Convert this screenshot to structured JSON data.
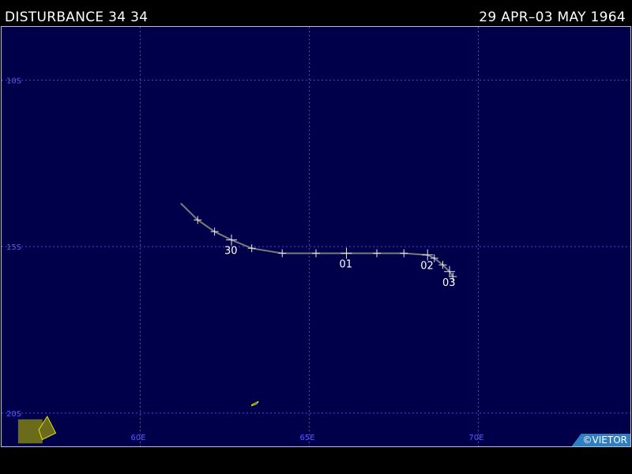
{
  "header": {
    "title": "DISTURBANCE 34 34",
    "date_range": "29 APR–03 MAY 1964"
  },
  "map": {
    "lon_range": [
      55.9,
      74.5
    ],
    "lat_range": [
      -21.0,
      -8.4
    ],
    "lat_grid": [
      {
        "lat": -10,
        "label": "10S"
      },
      {
        "lat": -15,
        "label": "15S"
      },
      {
        "lat": -20,
        "label": "20S"
      }
    ],
    "lon_grid": [
      {
        "lon": 60,
        "label": "60E"
      },
      {
        "lon": 65,
        "label": "65E"
      },
      {
        "lon": 70,
        "label": "70E"
      }
    ],
    "track": [
      {
        "lon": 61.2,
        "lat": -13.7
      },
      {
        "lon": 61.7,
        "lat": -14.2
      },
      {
        "lon": 62.2,
        "lat": -14.55
      },
      {
        "lon": 62.7,
        "lat": -14.8
      },
      {
        "lon": 63.3,
        "lat": -15.05
      },
      {
        "lon": 64.2,
        "lat": -15.2
      },
      {
        "lon": 65.2,
        "lat": -15.2
      },
      {
        "lon": 66.1,
        "lat": -15.2
      },
      {
        "lon": 67.0,
        "lat": -15.2
      },
      {
        "lon": 67.8,
        "lat": -15.2
      },
      {
        "lon": 68.5,
        "lat": -15.25
      },
      {
        "lon": 68.7,
        "lat": -15.35
      },
      {
        "lon": 68.95,
        "lat": -15.55
      },
      {
        "lon": 69.15,
        "lat": -15.75
      },
      {
        "lon": 69.25,
        "lat": -15.9
      }
    ],
    "fixes": [
      {
        "lon": 61.7,
        "lat": -14.2,
        "major": false
      },
      {
        "lon": 62.2,
        "lat": -14.55,
        "major": false
      },
      {
        "lon": 62.7,
        "lat": -14.8,
        "major": true,
        "label": "30"
      },
      {
        "lon": 63.3,
        "lat": -15.05,
        "major": false
      },
      {
        "lon": 64.2,
        "lat": -15.2,
        "major": false
      },
      {
        "lon": 65.2,
        "lat": -15.2,
        "major": false
      },
      {
        "lon": 66.1,
        "lat": -15.2,
        "major": true,
        "label": "01"
      },
      {
        "lon": 67.0,
        "lat": -15.2,
        "major": false
      },
      {
        "lon": 67.8,
        "lat": -15.2,
        "major": false
      },
      {
        "lon": 68.5,
        "lat": -15.25,
        "major": true,
        "label": "02"
      },
      {
        "lon": 68.7,
        "lat": -15.35,
        "major": false
      },
      {
        "lon": 68.95,
        "lat": -15.55,
        "major": false
      },
      {
        "lon": 69.15,
        "lat": -15.75,
        "major": true,
        "label": "03"
      },
      {
        "lon": 69.25,
        "lat": -15.9,
        "major": false
      }
    ],
    "islands": [
      {
        "name": "reunion",
        "points": [
          [
            56.4,
            -20.9
          ],
          [
            57.1,
            -20.9
          ],
          [
            57.1,
            -20.2
          ],
          [
            56.4,
            -20.2
          ]
        ],
        "fill": "#6b6b1c",
        "stroke": "#6b6b1c"
      },
      {
        "name": "mauritius",
        "points": [
          [
            57.1,
            -20.8
          ],
          [
            57.5,
            -20.6
          ],
          [
            57.25,
            -20.1
          ],
          [
            57.0,
            -20.5
          ]
        ],
        "fill": "#6b6b1c",
        "stroke": "#e6e600"
      },
      {
        "name": "rodrigues",
        "points": [
          [
            63.3,
            -19.75
          ],
          [
            63.5,
            -19.65
          ],
          [
            63.45,
            -19.72
          ],
          [
            63.3,
            -19.78
          ]
        ],
        "fill": "none",
        "stroke": "#e6e600"
      }
    ],
    "colors": {
      "background": "#00004a",
      "grid": "#4a4ad8",
      "grid_label": "#5a5aff",
      "track": "#7a7a7a",
      "fix_mark": "#e8e8e8",
      "date_label": "#ffffff"
    }
  },
  "credit": "©VIETOR"
}
